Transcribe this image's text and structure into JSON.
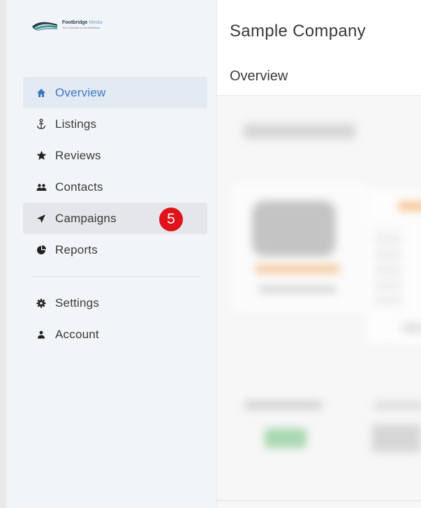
{
  "brand": {
    "name_part1": "Footbridge",
    "name_part2": "Media",
    "tagline": "Your Success Is Our Business"
  },
  "header": {
    "company": "Sample Company"
  },
  "subheader": {
    "page_title": "Overview"
  },
  "sidebar": {
    "items": [
      {
        "label": "Overview",
        "icon": "home-icon",
        "active": true
      },
      {
        "label": "Listings",
        "icon": "anchor-icon"
      },
      {
        "label": "Reviews",
        "icon": "star-icon"
      },
      {
        "label": "Contacts",
        "icon": "users-icon"
      },
      {
        "label": "Campaigns",
        "icon": "send-icon",
        "hovered": true,
        "badge": "5"
      },
      {
        "label": "Reports",
        "icon": "pie-chart-icon"
      }
    ],
    "secondary_items": [
      {
        "label": "Settings",
        "icon": "gear-icon"
      },
      {
        "label": "Account",
        "icon": "user-icon"
      }
    ]
  },
  "colors": {
    "accent": "#3b78c0",
    "active_bg": "#e3eaf4",
    "badge": "#e0121b",
    "sidebar_bg": "#f2f5f8"
  }
}
